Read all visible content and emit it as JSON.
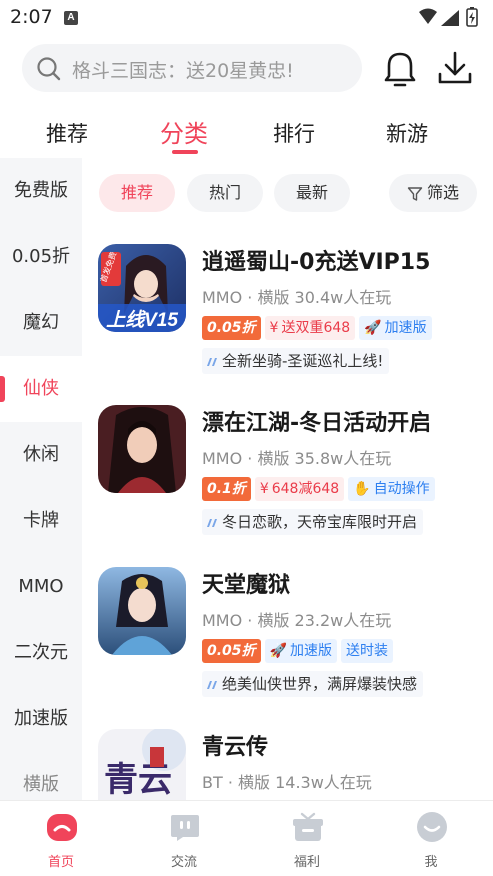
{
  "status": {
    "time": "2:07",
    "notif_letter": "A"
  },
  "search": {
    "placeholder": "格斗三国志：送20星黄忠!"
  },
  "top_tabs": [
    "推荐",
    "分类",
    "排行",
    "新游"
  ],
  "sidebar": [
    "免费版",
    "0.05折",
    "魔幻",
    "仙侠",
    "休闲",
    "卡牌",
    "MMO",
    "二次元",
    "加速版",
    "横版"
  ],
  "chips": {
    "recommend": "推荐",
    "hot": "热门",
    "latest": "最新",
    "filter": "筛选"
  },
  "games": [
    {
      "title": "逍遥蜀山-0充送VIP15",
      "meta": "MMO · 横版  30.4w人在玩",
      "tags": [
        "0.05折",
        "送双重648",
        "加速版"
      ],
      "desc": "全新坐骑-圣诞巡礼上线!",
      "icon_text": "上线V15",
      "icon_badge": "首发免费"
    },
    {
      "title": "漂在江湖-冬日活动开启",
      "meta": "MMO · 横版  35.8w人在玩",
      "tags": [
        "0.1折",
        "648减648",
        "自动操作"
      ],
      "desc": "冬日恋歌，天帝宝库限时开启"
    },
    {
      "title": "天堂魔狱",
      "meta": "MMO · 横版  23.2w人在玩",
      "tags": [
        "0.05折",
        "加速版",
        "送时装"
      ],
      "desc": "绝美仙侠世界，满屏爆装快感"
    },
    {
      "title": "青云传",
      "meta": "BT · 横版  14.3w人在玩",
      "icon_text": "青云"
    }
  ],
  "bottom_nav": [
    "首页",
    "交流",
    "福利",
    "我"
  ],
  "colors": {
    "accent": "#f0445a",
    "discount": "#f26a3a",
    "blue_tag": "#2d7ff0"
  }
}
